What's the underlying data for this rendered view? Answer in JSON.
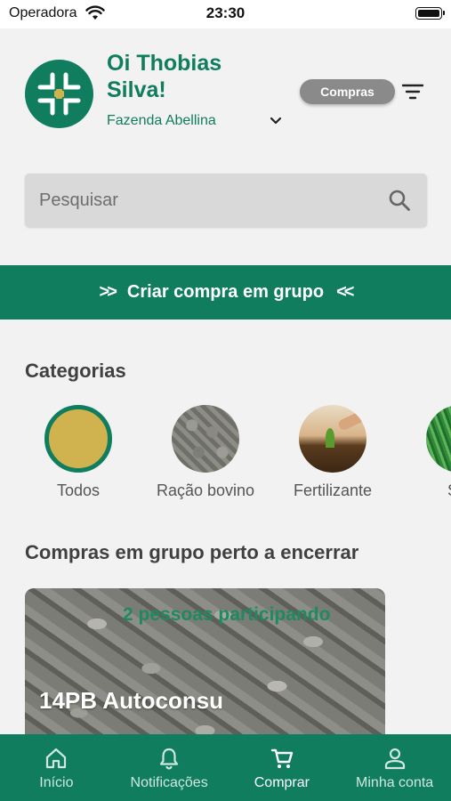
{
  "status_bar": {
    "carrier": "Operadora",
    "time": "23:30"
  },
  "header": {
    "greeting": "Oi Thobias Silva!",
    "farm": "Fazenda Abellina",
    "mode_label": "Compras"
  },
  "search": {
    "placeholder": "Pesquisar"
  },
  "group_banner": {
    "label": "Criar compra em grupo"
  },
  "categories": {
    "title": "Categorias",
    "items": [
      {
        "label": "Todos",
        "selected": true
      },
      {
        "label": "Ração bovino"
      },
      {
        "label": "Fertilizante"
      },
      {
        "label": "Ser"
      }
    ]
  },
  "closing_soon": {
    "title": "Compras em grupo perto a encerrar",
    "cards": [
      {
        "participants": "2 pessoas participando",
        "name": "14PB Autoconsu"
      }
    ]
  },
  "tab_bar": {
    "tabs": [
      {
        "label": "Início",
        "icon": "home-icon"
      },
      {
        "label": "Notificações",
        "icon": "bell-icon"
      },
      {
        "label": "Comprar",
        "icon": "cart-icon",
        "active": true
      },
      {
        "label": "Minha conta",
        "icon": "user-icon"
      }
    ]
  },
  "colors": {
    "primary": "#0f7d5e",
    "pill": "#8a8a8a",
    "background": "#f2f2f2"
  }
}
